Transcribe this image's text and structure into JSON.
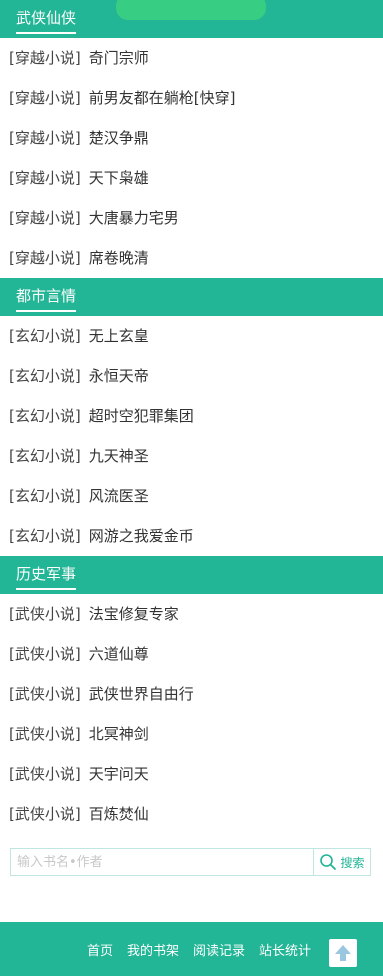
{
  "sections": [
    {
      "title": "武侠仙侠",
      "items": [
        {
          "category": "[穿越小说]",
          "name": "奇门宗师"
        },
        {
          "category": "[穿越小说]",
          "name": "前男友都在躺枪[快穿]"
        },
        {
          "category": "[穿越小说]",
          "name": "楚汉争鼎"
        },
        {
          "category": "[穿越小说]",
          "name": "天下枭雄"
        },
        {
          "category": "[穿越小说]",
          "name": "大唐暴力宅男"
        },
        {
          "category": "[穿越小说]",
          "name": "席卷晚清"
        }
      ]
    },
    {
      "title": "都市言情",
      "items": [
        {
          "category": "[玄幻小说]",
          "name": "无上玄皇"
        },
        {
          "category": "[玄幻小说]",
          "name": "永恒天帝"
        },
        {
          "category": "[玄幻小说]",
          "name": "超时空犯罪集团"
        },
        {
          "category": "[玄幻小说]",
          "name": "九天神圣"
        },
        {
          "category": "[玄幻小说]",
          "name": "风流医圣"
        },
        {
          "category": "[玄幻小说]",
          "name": "网游之我爱金币"
        }
      ]
    },
    {
      "title": "历史军事",
      "items": [
        {
          "category": "[武侠小说]",
          "name": "法宝修复专家"
        },
        {
          "category": "[武侠小说]",
          "name": "六道仙尊"
        },
        {
          "category": "[武侠小说]",
          "name": "武侠世界自由行"
        },
        {
          "category": "[武侠小说]",
          "name": "北冥神剑"
        },
        {
          "category": "[武侠小说]",
          "name": "天宇问天"
        },
        {
          "category": "[武侠小说]",
          "name": "百炼焚仙"
        }
      ]
    }
  ],
  "search": {
    "placeholder": "输入书名•作者",
    "value": "",
    "button_label": "搜索",
    "icon": "search-icon"
  },
  "footer": {
    "links": [
      "首页",
      "我的书架",
      "阅读记录",
      "站长统计"
    ],
    "back_to_top_icon": "arrow-up-icon"
  },
  "colors": {
    "accent": "#22b596",
    "text": "#333333",
    "placeholder": "#c8c8c8"
  }
}
